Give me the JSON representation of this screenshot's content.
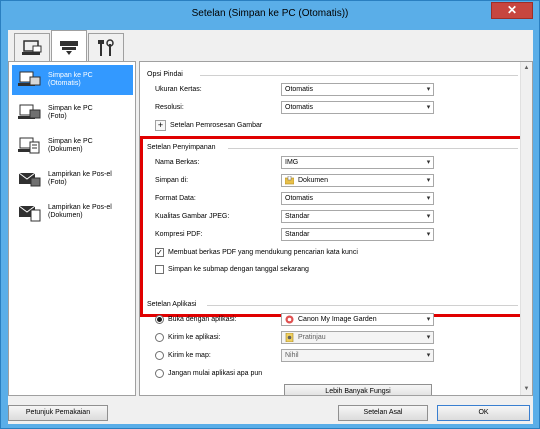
{
  "window": {
    "title": "Setelan (Simpan ke PC (Otomatis))",
    "close": "✕"
  },
  "tabs": [
    {
      "icon": "scan-to-pc-icon"
    },
    {
      "icon": "scanner-icon"
    },
    {
      "icon": "tools-icon"
    }
  ],
  "sidebar": {
    "items": [
      {
        "label": "Simpan ke PC\n(Otomatis)",
        "icon": "save-auto-icon",
        "selected": true
      },
      {
        "label": "Simpan ke PC\n(Foto)",
        "icon": "save-photo-icon",
        "selected": false
      },
      {
        "label": "Simpan ke PC\n(Dokumen)",
        "icon": "save-document-icon",
        "selected": false
      },
      {
        "label": "Lampirkan ke Pos-el\n(Foto)",
        "icon": "email-photo-icon",
        "selected": false
      },
      {
        "label": "Lampirkan ke Pos-el\n(Dokumen)",
        "icon": "email-document-icon",
        "selected": false
      }
    ]
  },
  "scan_options": {
    "title": "Opsi Pindai",
    "paper_size_label": "Ukuran Kertas:",
    "paper_size_value": "Otomatis",
    "resolution_label": "Resolusi:",
    "resolution_value": "Otomatis",
    "image_processing_label": "Setelan Pemrosesan Gambar",
    "plus": "+"
  },
  "save_settings": {
    "title": "Setelan Penyimpanan",
    "file_name_label": "Nama Berkas:",
    "file_name_value": "IMG",
    "save_in_label": "Simpan di:",
    "save_in_value": "Dokumen",
    "data_format_label": "Format Data:",
    "data_format_value": "Otomatis",
    "jpeg_quality_label": "Kualitas Gambar JPEG:",
    "jpeg_quality_value": "Standar",
    "pdf_compression_label": "Kompresi PDF:",
    "pdf_compression_value": "Standar",
    "keyword_search_label": "Membuat berkas PDF yang mendukung pencarian kata kunci",
    "keyword_search_checked": true,
    "subfolder_label": "Simpan ke submap dengan tanggal sekarang",
    "subfolder_checked": false,
    "check_mark": "✓"
  },
  "app_settings": {
    "title": "Setelan Aplikasi",
    "open_with_label": "Buka dengan aplikasi:",
    "open_with_value": "Canon My Image Garden",
    "send_app_label": "Kirim ke aplikasi:",
    "send_app_value": "Pratinjau",
    "send_folder_label": "Kirim ke map:",
    "send_folder_value": "Nihil",
    "no_app_label": "Jangan mulai aplikasi apa pun",
    "more_functions_label": "Lebih Banyak Fungsi",
    "selected": "open_with"
  },
  "footer": {
    "instructions_label": "Petunjuk Pemakaian",
    "defaults_label": "Setelan Asal",
    "ok_label": "OK"
  },
  "colors": {
    "accent": "#3399ff",
    "highlight_border": "#e00000",
    "title_bar": "#5aaee8"
  }
}
